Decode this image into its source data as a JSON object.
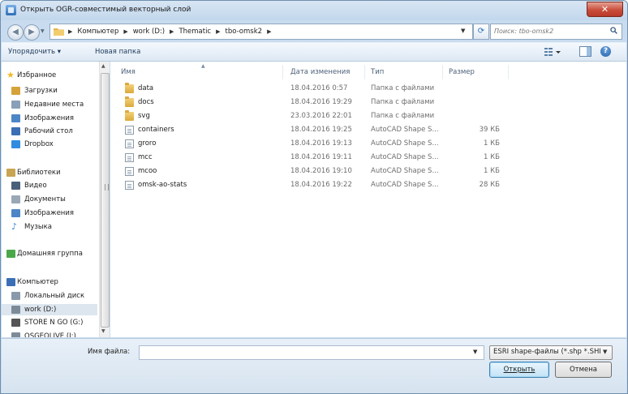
{
  "window": {
    "title": "Открыть OGR-совместимый векторный слой",
    "close_label": "✕"
  },
  "address": {
    "crumbs": [
      "Компьютер",
      "work (D:)",
      "Thematic",
      "tbo-omsk2"
    ]
  },
  "search": {
    "placeholder": "Поиск: tbo-omsk2"
  },
  "toolbar": {
    "organize_label": "Упорядочить ▾",
    "new_folder_label": "Новая папка"
  },
  "sidebar": {
    "items": [
      {
        "label": "Избранное",
        "icon": "star-icon"
      },
      {
        "label": "Загрузки",
        "icon": "downloads-icon"
      },
      {
        "label": "Недавние места",
        "icon": "recent-places-icon"
      },
      {
        "label": "Изображения",
        "icon": "pictures-icon"
      },
      {
        "label": "Рабочий стол",
        "icon": "desktop-icon"
      },
      {
        "label": "Dropbox",
        "icon": "dropbox-icon"
      },
      {
        "label": "Библиотеки",
        "icon": "libraries-icon"
      },
      {
        "label": "Видео",
        "icon": "video-icon"
      },
      {
        "label": "Документы",
        "icon": "documents-icon"
      },
      {
        "label": "Изображения",
        "icon": "pictures-icon"
      },
      {
        "label": "Музыка",
        "icon": "music-icon"
      },
      {
        "label": "Домашняя группа",
        "icon": "homegroup-icon"
      },
      {
        "label": "Компьютер",
        "icon": "computer-icon"
      },
      {
        "label": "Локальный диск",
        "icon": "local-disk-icon"
      },
      {
        "label": "work (D:)",
        "icon": "drive-icon"
      },
      {
        "label": "STORE N GO (G:)",
        "icon": "usb-drive-icon"
      },
      {
        "label": "OSGEOLIVE (I:)",
        "icon": "drive-icon"
      }
    ]
  },
  "filelist": {
    "columns": {
      "name": "Имя",
      "date": "Дата изменения",
      "type": "Тип",
      "size": "Размер"
    },
    "rows": [
      {
        "name": "data",
        "date": "18.04.2016 0:57",
        "type": "Папка с файлами",
        "size": "",
        "kind": "folder"
      },
      {
        "name": "docs",
        "date": "18.04.2016 19:29",
        "type": "Папка с файлами",
        "size": "",
        "kind": "folder"
      },
      {
        "name": "svg",
        "date": "23.03.2016 22:01",
        "type": "Папка с файлами",
        "size": "",
        "kind": "folder"
      },
      {
        "name": "containers",
        "date": "18.04.2016 19:25",
        "type": "AutoCAD Shape S...",
        "size": "39 КБ",
        "kind": "file"
      },
      {
        "name": "groro",
        "date": "18.04.2016 19:13",
        "type": "AutoCAD Shape S...",
        "size": "1 КБ",
        "kind": "file"
      },
      {
        "name": "mcc",
        "date": "18.04.2016 19:11",
        "type": "AutoCAD Shape S...",
        "size": "1 КБ",
        "kind": "file"
      },
      {
        "name": "mcoo",
        "date": "18.04.2016 19:10",
        "type": "AutoCAD Shape S...",
        "size": "1 КБ",
        "kind": "file"
      },
      {
        "name": "omsk-ao-stats",
        "date": "18.04.2016 19:22",
        "type": "AutoCAD Shape S...",
        "size": "28 КБ",
        "kind": "file"
      }
    ]
  },
  "bottom": {
    "filename_label": "Имя файла:",
    "filename_value": "",
    "filter_value": "ESRI shape-файлы (*.shp *.SHP",
    "open_label": "Открыть",
    "cancel_label": "Отмена"
  },
  "colors": {
    "accent": "#3c7fb1",
    "close_button": "#c94d3a",
    "chrome": "#c9dcef"
  }
}
